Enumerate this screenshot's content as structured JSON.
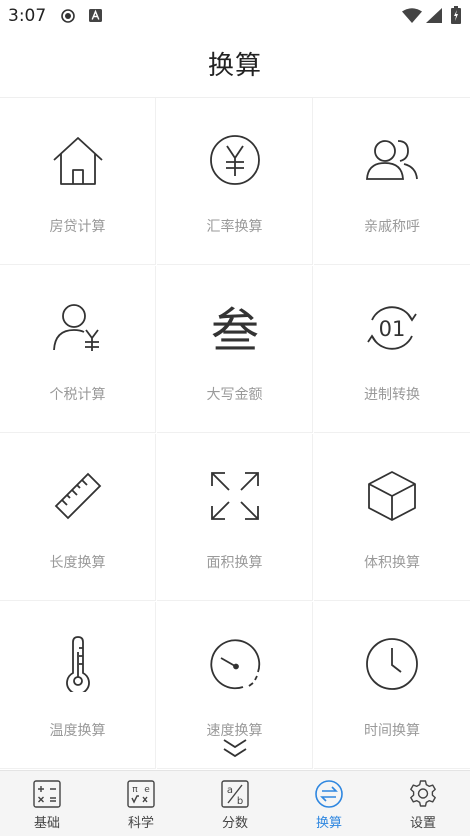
{
  "status_bar": {
    "time": "3:07"
  },
  "header": {
    "title": "换算"
  },
  "tools": [
    {
      "label": "房贷计算",
      "icon": "house-icon"
    },
    {
      "label": "汇率换算",
      "icon": "yuan-coin-icon"
    },
    {
      "label": "亲戚称呼",
      "icon": "people-icon"
    },
    {
      "label": "个税计算",
      "icon": "person-yuan-icon"
    },
    {
      "label": "大写金额",
      "icon": "chinese-numeral-icon"
    },
    {
      "label": "进制转换",
      "icon": "binary-cycle-icon"
    },
    {
      "label": "长度换算",
      "icon": "ruler-icon"
    },
    {
      "label": "面积换算",
      "icon": "expand-arrows-icon"
    },
    {
      "label": "体积换算",
      "icon": "cube-icon"
    },
    {
      "label": "温度换算",
      "icon": "thermometer-icon"
    },
    {
      "label": "速度换算",
      "icon": "speedometer-icon"
    },
    {
      "label": "时间换算",
      "icon": "clock-icon"
    }
  ],
  "icon_glyphs": {
    "chinese_numeral": "叁",
    "binary": "01",
    "fraction_a": "a",
    "fraction_b": "b",
    "science_pi": "π",
    "science_e": "e"
  },
  "bottom_nav": [
    {
      "label": "基础",
      "icon": "basic-calculator-icon",
      "active": false
    },
    {
      "label": "科学",
      "icon": "scientific-calculator-icon",
      "active": false
    },
    {
      "label": "分数",
      "icon": "fraction-icon",
      "active": false
    },
    {
      "label": "换算",
      "icon": "convert-icon",
      "active": true
    },
    {
      "label": "设置",
      "icon": "settings-gear-icon",
      "active": false
    }
  ],
  "colors": {
    "accent": "#2f87e0",
    "label_gray": "#9a9a9a",
    "icon_dark": "#333333",
    "nav_bg": "#f5f5f5"
  }
}
